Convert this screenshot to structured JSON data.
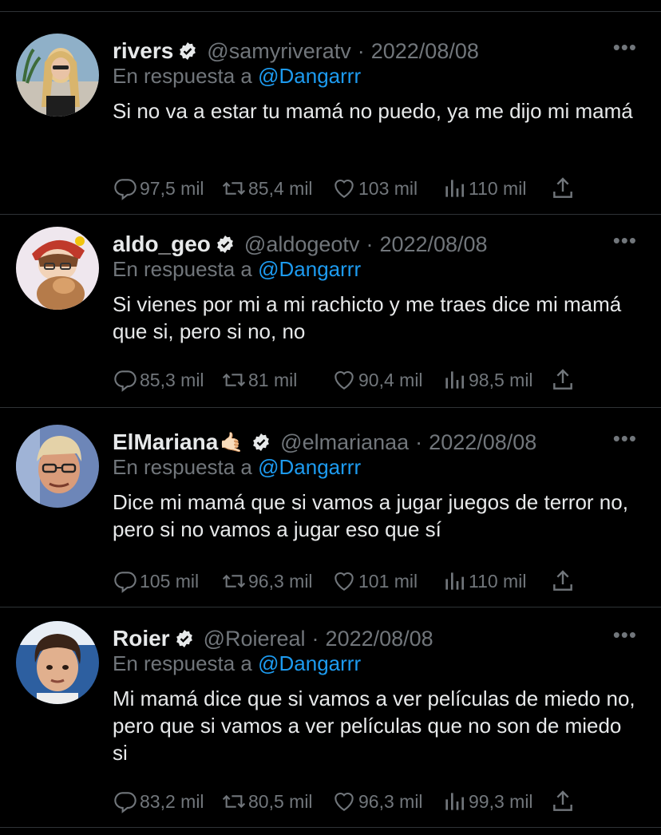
{
  "reply_prefix": "En respuesta a",
  "reply_to": "@Dangarrr",
  "more_glyph": "•••",
  "colors": {
    "background": "#000000",
    "text": "#e7e9ea",
    "muted": "#71767b",
    "link": "#1d9bf0",
    "divider": "#2f3336"
  },
  "tweets": [
    {
      "name": "rivers",
      "emoji": "",
      "handle": "@samyriveratv",
      "date": "2022/08/08",
      "text": "Si no va a estar tu mamá no puedo, ya me dijo mi mamá",
      "replies": "97,5 mil",
      "retweets": "85,4 mil",
      "likes": "103 mil",
      "views": "110 mil"
    },
    {
      "name": "aldo_geo",
      "emoji": "",
      "handle": "@aldogeotv",
      "date": "2022/08/08",
      "text": "Si vienes por mi a mi rachicto y me traes dice mi mamá que si, pero si no, no",
      "replies": "85,3 mil",
      "retweets": "81 mil",
      "likes": "90,4 mil",
      "views": "98,5 mil"
    },
    {
      "name": "ElMariana",
      "emoji": "🤙🏻",
      "handle": "@elmarianaa",
      "date": "2022/08/08",
      "text": "Dice mi mamá que si vamos a jugar juegos de terror no, pero si no vamos a jugar eso que sí",
      "replies": "105 mil",
      "retweets": "96,3 mil",
      "likes": "101 mil",
      "views": "110 mil"
    },
    {
      "name": "Roier",
      "emoji": "",
      "handle": "@Roiereal",
      "date": "2022/08/08",
      "text": "Mi mamá dice que si vamos a ver películas de miedo no, pero que si vamos a ver películas que no son de miedo si",
      "replies": "83,2 mil",
      "retweets": "80,5 mil",
      "likes": "96,3 mil",
      "views": "99,3 mil"
    }
  ]
}
